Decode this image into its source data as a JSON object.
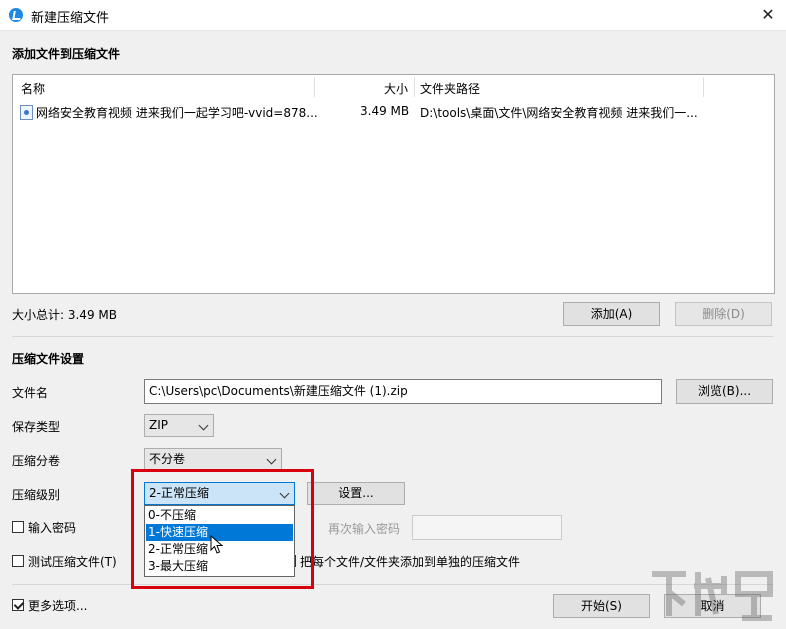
{
  "window": {
    "title": "新建压缩文件",
    "close_glyph": "✕"
  },
  "add_section": {
    "title": "添加文件到压缩文件"
  },
  "file_table": {
    "columns": [
      "名称",
      "大小",
      "文件夹路径"
    ],
    "rows": [
      {
        "name": "网络安全教育视频 进来我们一起学习吧-vvid=878...",
        "size": "3.49 MB",
        "path": "D:\\tools\\桌面\\文件\\网络安全教育视频 进来我们一..."
      }
    ]
  },
  "total_size": "大小总计: 3.49 MB",
  "buttons": {
    "add": "添加(A)",
    "delete": "删除(D)",
    "browse": "浏览(B)...",
    "settings": "设置...",
    "start": "开始(S)",
    "cancel": "取消"
  },
  "settings_section": {
    "title": "压缩文件设置"
  },
  "fields": {
    "filename_label": "文件名",
    "filename_value": "C:\\Users\\pc\\Documents\\新建压缩文件 (1).zip",
    "save_type_label": "保存类型",
    "save_type_value": "ZIP",
    "split_label": "压缩分卷",
    "split_value": "不分卷",
    "level_label": "压缩级别",
    "level_value": "2-正常压缩",
    "password_label": "输入密码",
    "reenter_label": "再次输入密码",
    "test_label": "测试压缩文件(T)",
    "each_file_label": "把每个文件/文件夹添加到单独的压缩文件",
    "more_options_label": "更多选项..."
  },
  "level_options": [
    "0-不压缩",
    "1-快速压缩",
    "2-正常压缩",
    "3-最大压缩"
  ],
  "level_highlighted_index": 1,
  "watermark_text": "下载吧"
}
